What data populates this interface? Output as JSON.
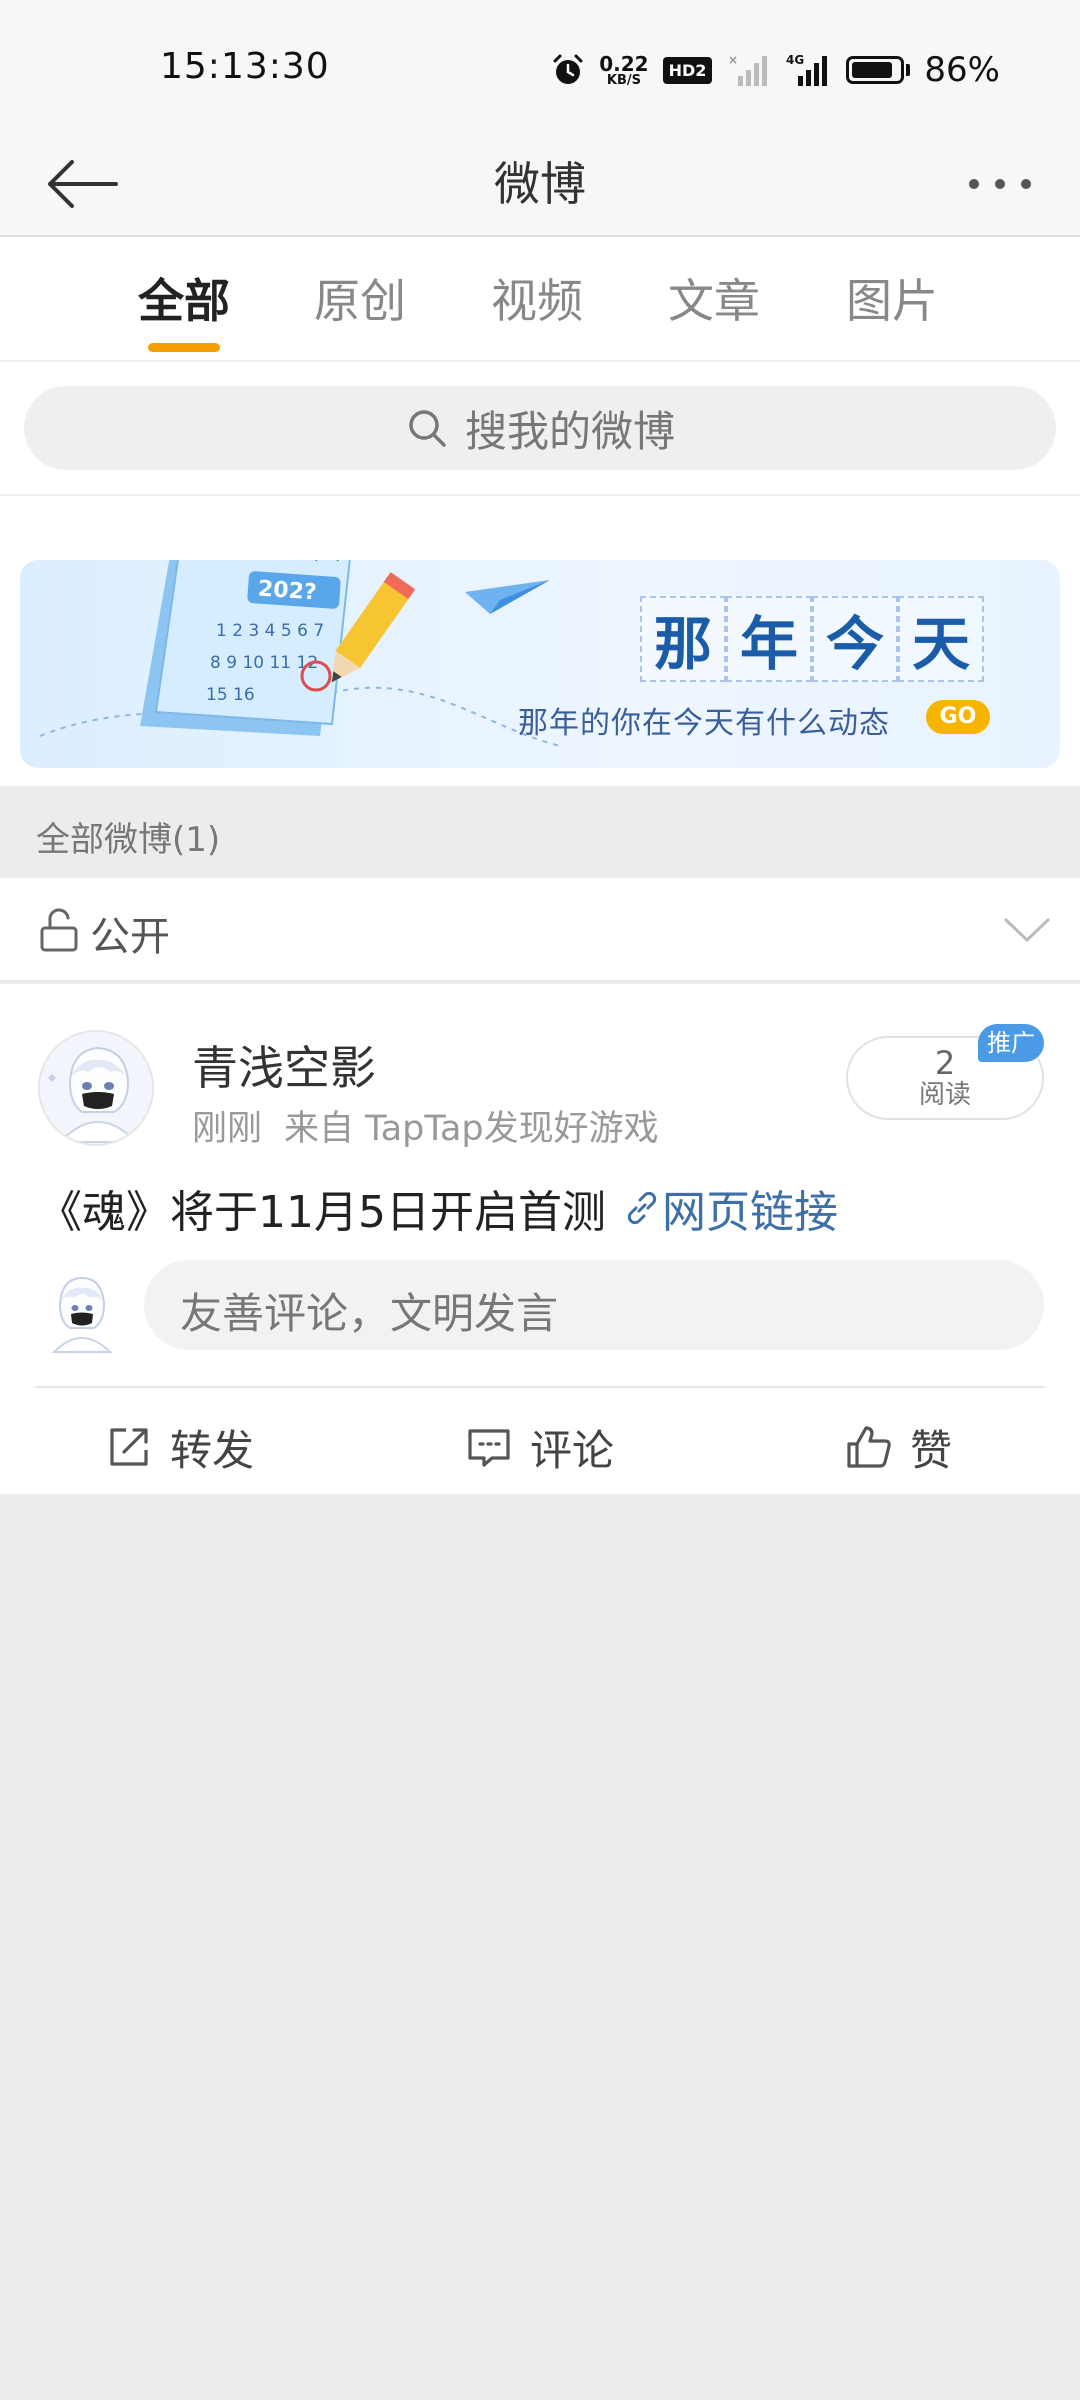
{
  "status_bar": {
    "time": "15:13:30",
    "net_speed_value": "0.22",
    "net_speed_unit": "KB/S",
    "hd_badge": "HD2",
    "signal_label": "4G",
    "battery_level": 0.86,
    "battery_percent": "86%"
  },
  "nav": {
    "title": "微博",
    "back_icon": "arrow-left-icon",
    "more_icon": "more-dots-icon"
  },
  "tabs": [
    {
      "label": "全部",
      "active": true
    },
    {
      "label": "原创",
      "active": false
    },
    {
      "label": "视频",
      "active": false
    },
    {
      "label": "文章",
      "active": false
    },
    {
      "label": "图片",
      "active": false
    }
  ],
  "search": {
    "placeholder": "搜我的微博"
  },
  "banner": {
    "art_year": "202?",
    "title_chars": [
      "那",
      "年",
      "今",
      "天"
    ],
    "subtitle": "那年的你在今天有什么动态",
    "go_label": "GO"
  },
  "section": {
    "header": "全部微博(1)"
  },
  "visibility": {
    "label": "公开"
  },
  "post": {
    "username": "青浅空影",
    "time": "刚刚",
    "source": "来自 TapTap发现好游戏",
    "read_count": "2",
    "read_label": "阅读",
    "promo_badge": "推广",
    "text": "《魂》将于11月5日开启首测",
    "link_text": "网页链接",
    "comment_placeholder": "友善评论，文明发言"
  },
  "actions": {
    "repost": "转发",
    "comment": "评论",
    "like": "赞"
  },
  "colors": {
    "accent_orange": "#f5a000",
    "link_blue": "#3f6fa8",
    "banner_blue": "#1a5ca8",
    "promo_blue": "#4a9ae6",
    "go_yellow": "#f7b500"
  }
}
